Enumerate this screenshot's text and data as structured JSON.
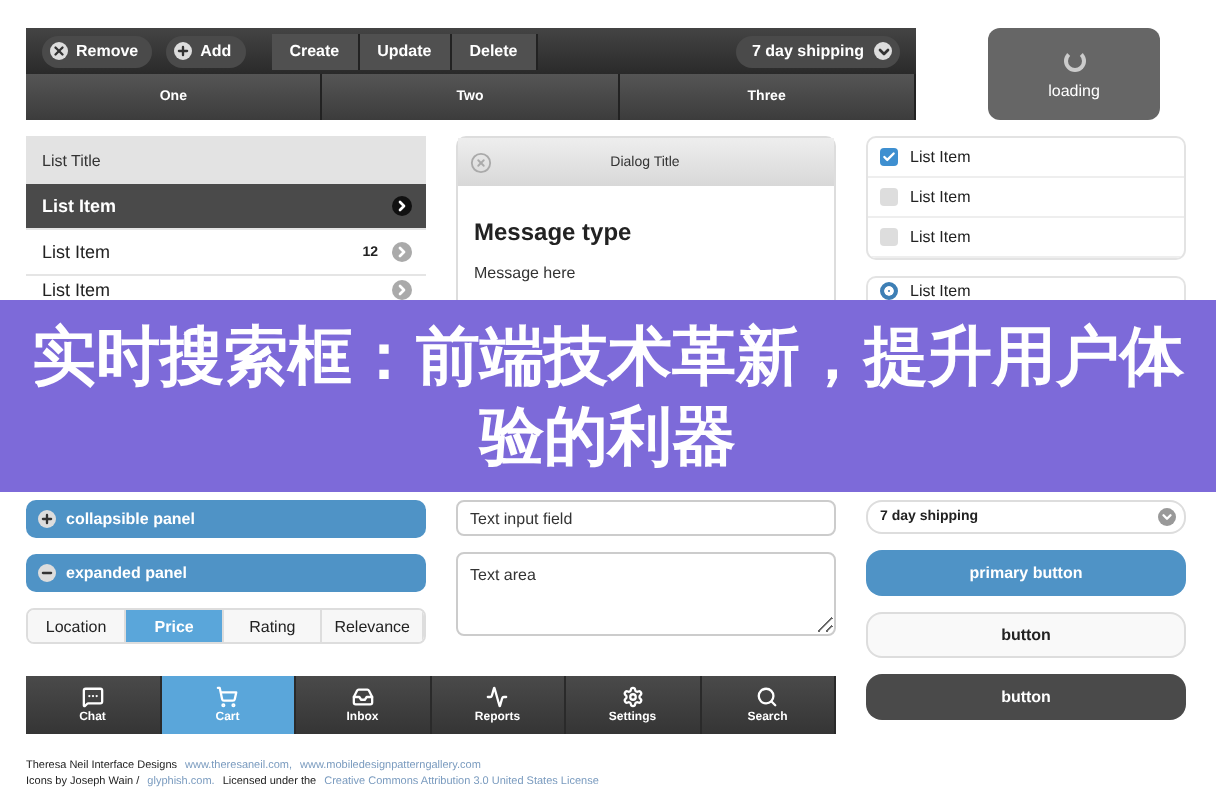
{
  "toolbar": {
    "buttons": [
      {
        "label": "Remove",
        "kind": "remove"
      },
      {
        "label": "Add",
        "kind": "add"
      }
    ],
    "group": [
      {
        "label": "Create"
      },
      {
        "label": "Update"
      },
      {
        "label": "Delete"
      }
    ],
    "select": {
      "value": "7 day shipping"
    }
  },
  "tabs": [
    {
      "label": "One",
      "selected": false
    },
    {
      "label": "Two",
      "selected": false
    },
    {
      "label": "Three",
      "selected": false
    }
  ],
  "loading": {
    "label": "loading"
  },
  "list": {
    "title": "List Title",
    "items": [
      {
        "label": "List Item",
        "selected": true
      },
      {
        "label": "List Item",
        "selected": false,
        "count": "12"
      },
      {
        "label": "List Item",
        "selected": false
      }
    ]
  },
  "dialog": {
    "title": "Dialog Title",
    "heading": "Message type",
    "message": "Message here"
  },
  "checklist": [
    {
      "label": "List Item",
      "checked": true
    },
    {
      "label": "List Item",
      "checked": false
    },
    {
      "label": "List Item",
      "checked": false
    }
  ],
  "radios": [
    {
      "label": "List Item",
      "selected": true
    }
  ],
  "banner": {
    "title": "实时搜索框：前端技术革新，提升用户体验的利器"
  },
  "panels": [
    {
      "label": "collapsible panel",
      "expanded": false
    },
    {
      "label": "expanded panel",
      "expanded": true
    }
  ],
  "sort": [
    {
      "label": "Location",
      "selected": false
    },
    {
      "label": "Price",
      "selected": true
    },
    {
      "label": "Rating",
      "selected": false
    },
    {
      "label": "Relevance",
      "selected": false
    }
  ],
  "input": {
    "placeholder": "Text input field"
  },
  "textarea": {
    "placeholder": "Text area"
  },
  "select": {
    "value": "7 day shipping"
  },
  "buttons": [
    {
      "label": "primary button",
      "kind": "primary"
    },
    {
      "label": "button",
      "kind": "plain"
    },
    {
      "label": "button",
      "kind": "dark"
    }
  ],
  "tab_bar": [
    {
      "label": "Chat",
      "kind": "chat",
      "selected": false
    },
    {
      "label": "Cart",
      "kind": "cart",
      "selected": true
    },
    {
      "label": "Inbox",
      "kind": "inbox",
      "selected": false
    },
    {
      "label": "Reports",
      "kind": "reports",
      "selected": false
    },
    {
      "label": "Settings",
      "kind": "settings",
      "selected": false
    },
    {
      "label": "Search",
      "kind": "search",
      "selected": false
    }
  ],
  "footer": [
    [
      {
        "text": "Theresa Neil Interface Designs",
        "kind": "text"
      },
      {
        "text": "www.theresaneil.com,",
        "kind": "link"
      },
      {
        "text": "www.mobiledesignpatterngallery.com",
        "kind": "link"
      }
    ],
    [
      {
        "text": "Icons by Joseph Wain /",
        "kind": "text"
      },
      {
        "text": "glyphish.com.",
        "kind": "link"
      },
      {
        "text": "Licensed under the",
        "kind": "text"
      },
      {
        "text": "Creative Commons Attribution 3.0 United States License",
        "kind": "link"
      }
    ]
  ]
}
